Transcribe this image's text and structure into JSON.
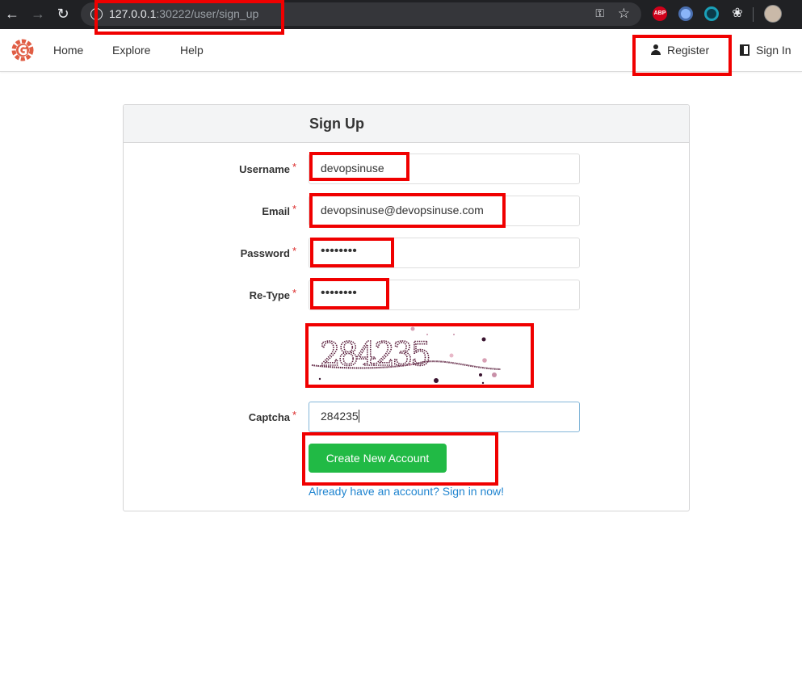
{
  "browser": {
    "url_host": "127.0.0.1",
    "url_rest": ":30222/user/sign_up",
    "abp_label": "ABP"
  },
  "nav": {
    "home": "Home",
    "explore": "Explore",
    "help": "Help",
    "register": "Register",
    "signin": "Sign In"
  },
  "form": {
    "title": "Sign Up",
    "username_label": "Username",
    "username_value": "devopsinuse",
    "email_label": "Email",
    "email_value": "devopsinuse@devopsinuse.com",
    "password_label": "Password",
    "password_value": "••••••••",
    "retype_label": "Re-Type",
    "retype_value": "••••••••",
    "captcha_label": "Captcha",
    "captcha_image_text": "284235",
    "captcha_value": "284235",
    "required_mark": "*",
    "submit": "Create New Account",
    "signin_link": "Already have an account? Sign in now!"
  },
  "colors": {
    "primary_button": "#21ba45",
    "link": "#2185d0",
    "required": "#db2828",
    "annotation": "#f00000"
  }
}
